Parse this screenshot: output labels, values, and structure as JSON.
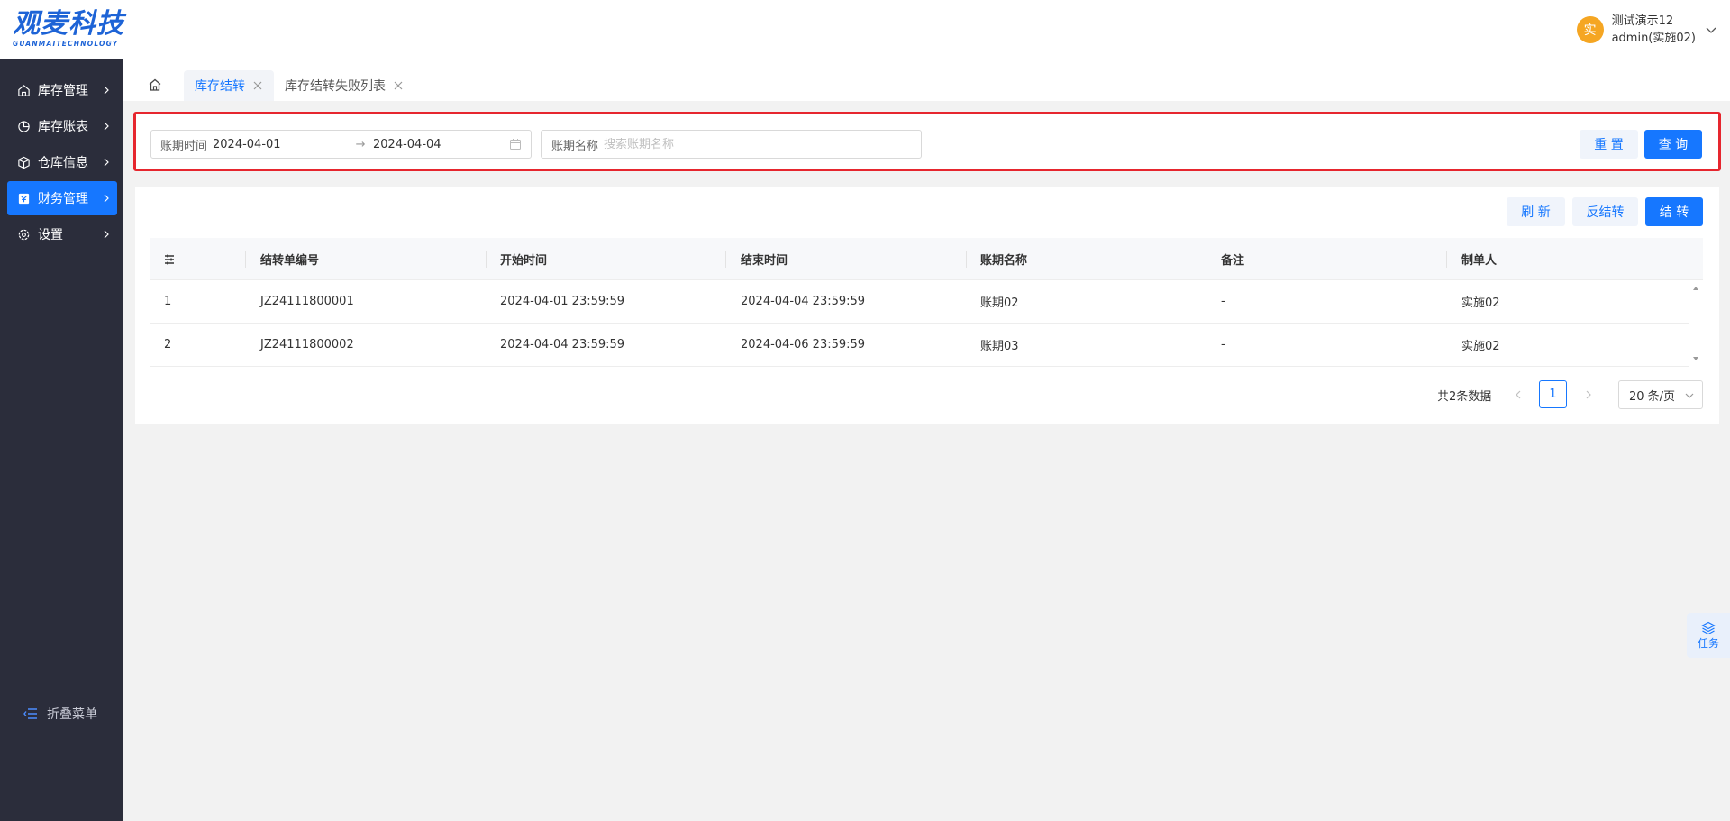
{
  "brand": {
    "name": "观麦科技",
    "sub": "GUANMAITECHNOLOGY",
    "color": "#1d63d6"
  },
  "user": {
    "avatar_char": "实",
    "name": "测试演示12",
    "account": "admin(实施02)"
  },
  "sidebar": {
    "items": [
      {
        "label": "库存管理",
        "icon": "home-warehouse-icon"
      },
      {
        "label": "库存账表",
        "icon": "pie-chart-icon"
      },
      {
        "label": "仓库信息",
        "icon": "box-icon"
      },
      {
        "label": "财务管理",
        "icon": "finance-icon",
        "active": true
      },
      {
        "label": "设置",
        "icon": "gear-icon"
      }
    ],
    "collapse_label": "折叠菜单"
  },
  "tabs": [
    {
      "label": "库存结转",
      "active": true
    },
    {
      "label": "库存结转失败列表",
      "active": false
    }
  ],
  "filter": {
    "date_label": "账期时间",
    "date_start": "2024-04-01",
    "date_end": "2024-04-04",
    "name_label": "账期名称",
    "name_placeholder": "搜索账期名称",
    "reset_label": "重 置",
    "search_label": "查 询"
  },
  "toolbar": {
    "refresh_label": "刷 新",
    "reverse_label": "反结转",
    "transfer_label": "结 转"
  },
  "table": {
    "columns": [
      "结转单编号",
      "开始时间",
      "结束时间",
      "账期名称",
      "备注",
      "制单人"
    ],
    "rows": [
      {
        "index": "1",
        "no": "JZ24111800001",
        "start": "2024-04-01 23:59:59",
        "end": "2024-04-04 23:59:59",
        "period": "账期02",
        "remark": "-",
        "creator": "实施02"
      },
      {
        "index": "2",
        "no": "JZ24111800002",
        "start": "2024-04-04 23:59:59",
        "end": "2024-04-06 23:59:59",
        "period": "账期03",
        "remark": "-",
        "creator": "实施02"
      }
    ]
  },
  "pagination": {
    "total_text": "共2条数据",
    "current_page": "1",
    "page_size": "20 条/页"
  },
  "float": {
    "task_label": "任务"
  },
  "colors": {
    "primary": "#1677ff",
    "sidebar_bg": "#2b2d3b",
    "highlight_border": "#e6262e"
  }
}
